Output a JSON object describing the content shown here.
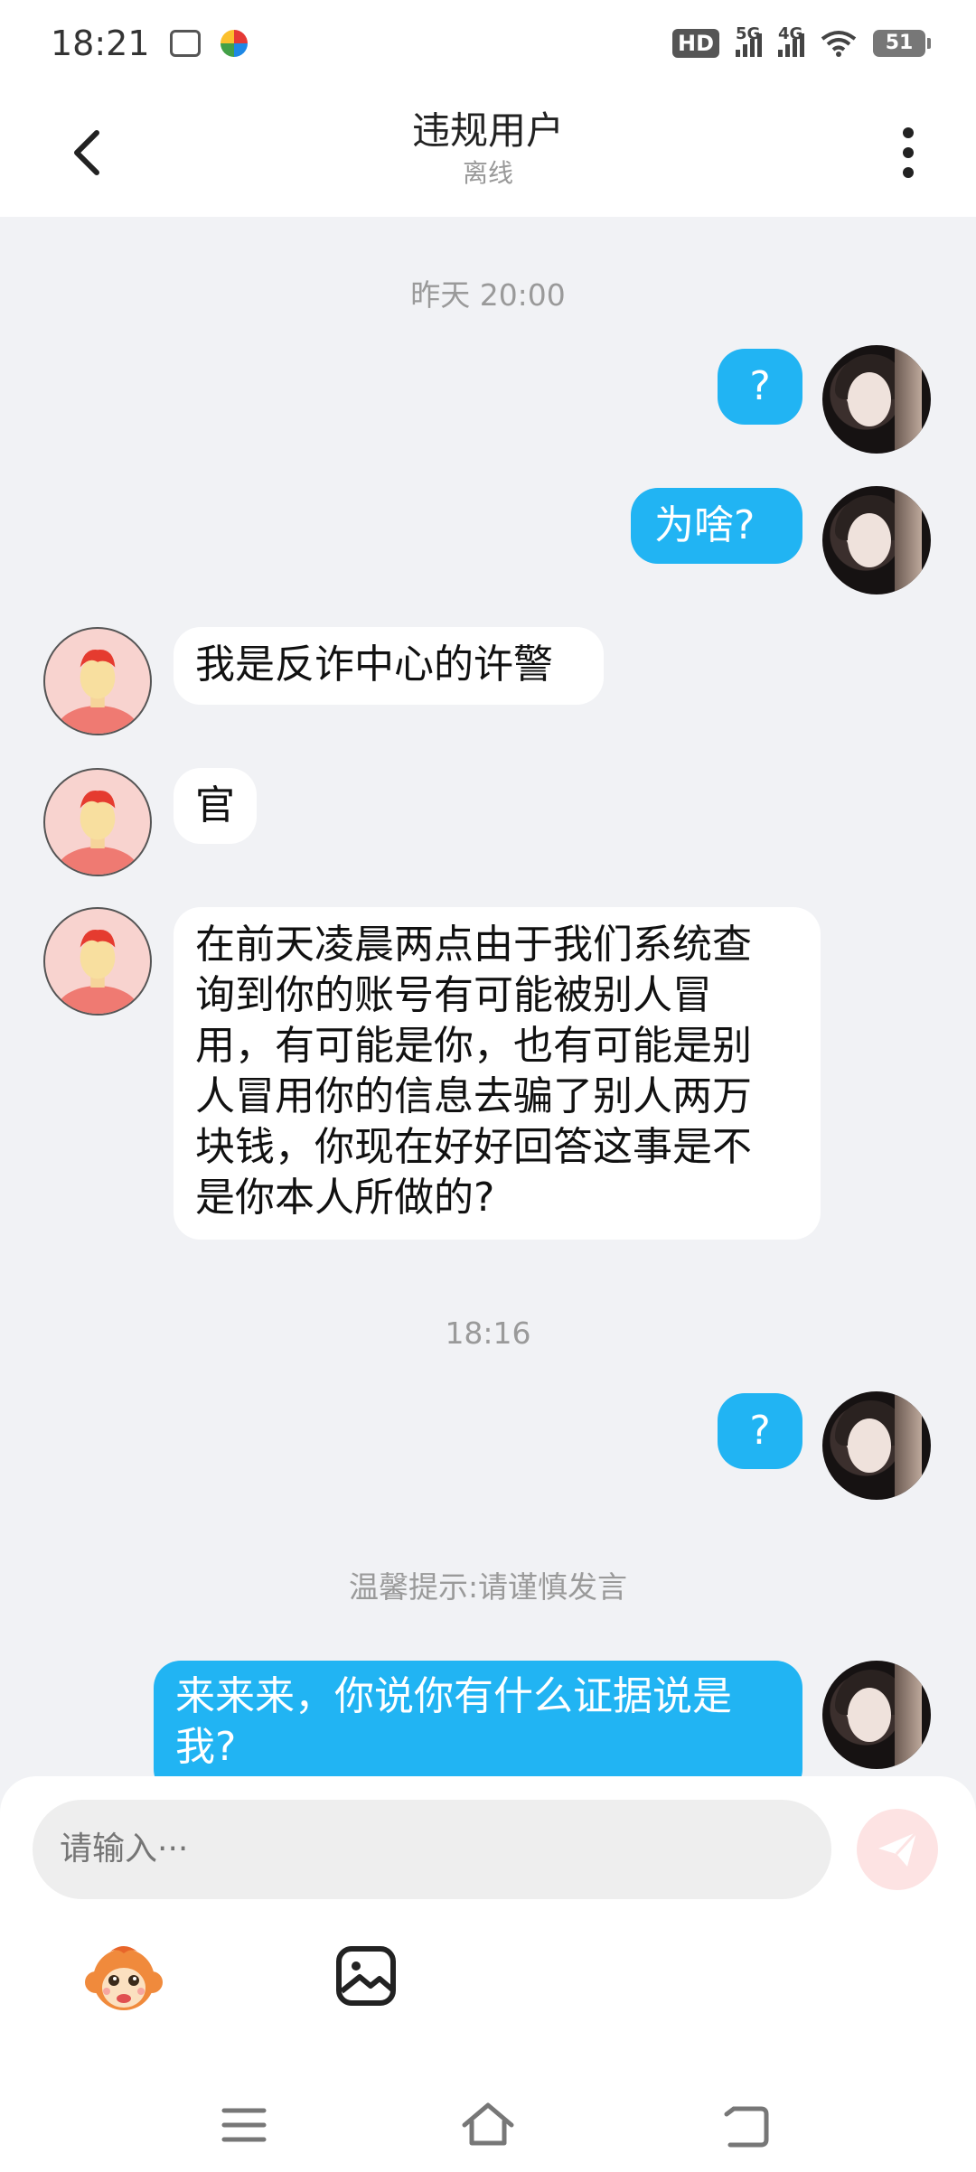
{
  "status_bar": {
    "time": "18:21",
    "hd_label": "HD",
    "signal_1_label": "5G",
    "signal_2_label": "4G",
    "battery": "51"
  },
  "header": {
    "title": "违规用户",
    "status": "离线",
    "back_icon": "chevron-left-icon",
    "more_icon": "more-vertical-icon"
  },
  "messages": {
    "timestamp_1": "昨天 20:00",
    "msg_1": "?",
    "msg_2": "为啥?",
    "msg_3": "我是反诈中心的许警",
    "msg_4": "官",
    "msg_5_line_1": "在前天凌晨两点由于我们系统查",
    "msg_5_line_2": "询到你的账号有可能被别人冒",
    "msg_5_line_3": "用，有可能是你，也有可能是别",
    "msg_5_line_4": "人冒用你的信息去骗了别人两万",
    "msg_5_line_5": "块钱，你现在好好回答这事是不",
    "msg_5_line_6": "是你本人所做的?",
    "timestamp_2": "18:16",
    "msg_6": "?",
    "tip": "温馨提示:请谨慎发言",
    "msg_7_line_1": "来来来，你说你有什么证据说是",
    "msg_7_line_2": "我?"
  },
  "input": {
    "placeholder": "请输入···"
  },
  "colors": {
    "bubble_self": "#21b4f3",
    "bubble_other": "#ffffff",
    "background": "#f1f2f5",
    "send_button": "#fde3e3"
  }
}
